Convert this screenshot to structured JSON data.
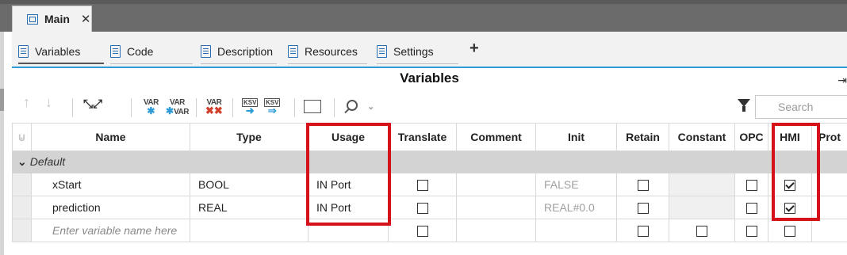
{
  "window": {
    "tab_label": "Main",
    "tab_close": "✕"
  },
  "subtabs": [
    {
      "label": "Variables",
      "icon": "variables-list-icon",
      "active": true
    },
    {
      "label": "Code",
      "icon": "code-file-icon",
      "active": false
    },
    {
      "label": "Description",
      "icon": "clipboard-icon",
      "active": false
    },
    {
      "label": "Resources",
      "icon": "resources-network-icon",
      "active": false
    },
    {
      "label": "Settings",
      "icon": "settings-window-icon",
      "active": false
    }
  ],
  "add_tab": "+",
  "panel": {
    "title": "Variables",
    "pin_glyph": "⇥",
    "search_placeholder": "Search"
  },
  "toolbar": {
    "move_up": "↑",
    "move_down": "↓",
    "collapse": "⤡⤢",
    "expand": "⤢",
    "var_label": "VAR",
    "var_plus": "✱",
    "var_x": "✖✖",
    "ksv_label": "KSV",
    "ksv_in": "➜",
    "ksv_out": "⇒",
    "columns_icon": "column-chooser-icon",
    "chevron": "⌄"
  },
  "columns": [
    "Name",
    "Type",
    "Usage",
    "Translate",
    "Comment",
    "Init",
    "Retain",
    "Constant",
    "OPC",
    "HMI",
    "Prot"
  ],
  "group": {
    "chevron": "⌄",
    "label": "Default"
  },
  "rows": [
    {
      "name": "xStart",
      "type": "BOOL",
      "usage": "IN Port",
      "translate": false,
      "comment": "",
      "init": "FALSE",
      "retain": false,
      "constant": null,
      "opc": false,
      "hmi": true
    },
    {
      "name": "prediction",
      "type": "REAL",
      "usage": "IN Port",
      "translate": false,
      "comment": "",
      "init": "REAL#0.0",
      "retain": false,
      "constant": null,
      "opc": false,
      "hmi": true
    }
  ],
  "new_row": {
    "placeholder": "Enter variable name here"
  },
  "highlight_color": "#d5111a",
  "accent_color": "#2e9ad6"
}
